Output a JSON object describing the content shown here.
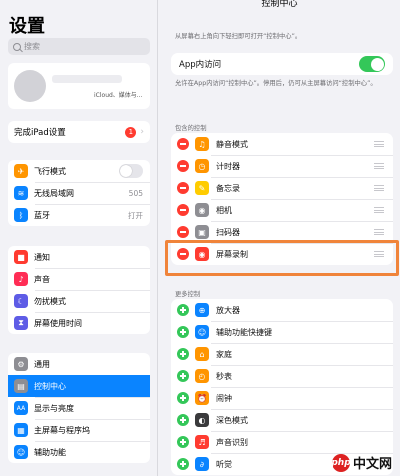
{
  "left": {
    "title": "设置",
    "search_placeholder": "搜索",
    "profile_sub": "iCloud、媒体与...",
    "setup": {
      "label": "完成iPad设置",
      "badge": "1"
    },
    "group1": [
      {
        "label": "飞行模式",
        "icon": "airplane-icon",
        "color": "#ff9500",
        "glyph": "✈",
        "control": "toggle"
      },
      {
        "label": "无线局域网",
        "icon": "wifi-icon",
        "color": "#0a84ff",
        "glyph": "≋",
        "value": "505"
      },
      {
        "label": "蓝牙",
        "icon": "bluetooth-icon",
        "color": "#0a84ff",
        "glyph": "ᛒ",
        "value": "打开"
      }
    ],
    "group2": [
      {
        "label": "通知",
        "icon": "notifications-icon",
        "color": "#ff3b30",
        "glyph": "■"
      },
      {
        "label": "声音",
        "icon": "sound-icon",
        "color": "#ff2d55",
        "glyph": "♪"
      },
      {
        "label": "勿扰模式",
        "icon": "moon-icon",
        "color": "#5e5ce6",
        "glyph": "☾"
      },
      {
        "label": "屏幕使用时间",
        "icon": "hourglass-icon",
        "color": "#5e5ce6",
        "glyph": "⧗"
      }
    ],
    "group3": [
      {
        "label": "通用",
        "icon": "gear-icon",
        "color": "#8e8e93",
        "glyph": "⚙"
      },
      {
        "label": "控制中心",
        "icon": "control-center-icon",
        "color": "#8e8e93",
        "glyph": "▤",
        "selected": true
      },
      {
        "label": "显示与亮度",
        "icon": "display-icon",
        "color": "#0a84ff",
        "glyph": "AA"
      },
      {
        "label": "主屏幕与程序坞",
        "icon": "home-screen-icon",
        "color": "#0a84ff",
        "glyph": "▦"
      },
      {
        "label": "辅助功能",
        "icon": "accessibility-icon",
        "color": "#0a84ff",
        "glyph": "☺"
      }
    ]
  },
  "right": {
    "title": "控制中心",
    "description": "从屏幕右上角向下轻扫即可打开“控制中心”。",
    "app_access": {
      "label": "App内访问",
      "on": true
    },
    "note": "允许在App内访问“控制中心”。停用后，仍可从主屏幕访问“控制中心”。",
    "included_header": "包含的控制",
    "included": [
      {
        "label": "静音模式",
        "icon": "bell-icon",
        "color": "#ff9500",
        "glyph": "♫"
      },
      {
        "label": "计时器",
        "icon": "timer-icon",
        "color": "#ff9500",
        "glyph": "◷"
      },
      {
        "label": "备忘录",
        "icon": "notes-icon",
        "color": "#ffcc00",
        "glyph": "✎"
      },
      {
        "label": "相机",
        "icon": "camera-icon",
        "color": "#8e8e93",
        "glyph": "◉"
      },
      {
        "label": "扫码器",
        "icon": "qr-scanner-icon",
        "color": "#8e8e93",
        "glyph": "▣"
      },
      {
        "label": "屏幕录制",
        "icon": "screen-record-icon",
        "color": "#ff3b30",
        "glyph": "◉",
        "highlighted": true
      }
    ],
    "more_header": "更多控制",
    "more": [
      {
        "label": "放大器",
        "icon": "magnifier-icon",
        "color": "#0a84ff",
        "glyph": "⊕"
      },
      {
        "label": "辅助功能快捷键",
        "icon": "accessibility-shortcut-icon",
        "color": "#0a84ff",
        "glyph": "☺"
      },
      {
        "label": "家庭",
        "icon": "home-icon",
        "color": "#ff9500",
        "glyph": "⌂"
      },
      {
        "label": "秒表",
        "icon": "stopwatch-icon",
        "color": "#ff9500",
        "glyph": "◴"
      },
      {
        "label": "闹钟",
        "icon": "alarm-icon",
        "color": "#ff9500",
        "glyph": "⏰"
      },
      {
        "label": "深色模式",
        "icon": "dark-mode-icon",
        "color": "#3a3a3c",
        "glyph": "◐"
      },
      {
        "label": "声音识别",
        "icon": "sound-recognition-icon",
        "color": "#ff3b30",
        "glyph": "♬"
      },
      {
        "label": "听觉",
        "icon": "hearing-icon",
        "color": "#0a84ff",
        "glyph": "∂"
      }
    ]
  },
  "watermark": {
    "text": "中文网",
    "logo": "php"
  }
}
